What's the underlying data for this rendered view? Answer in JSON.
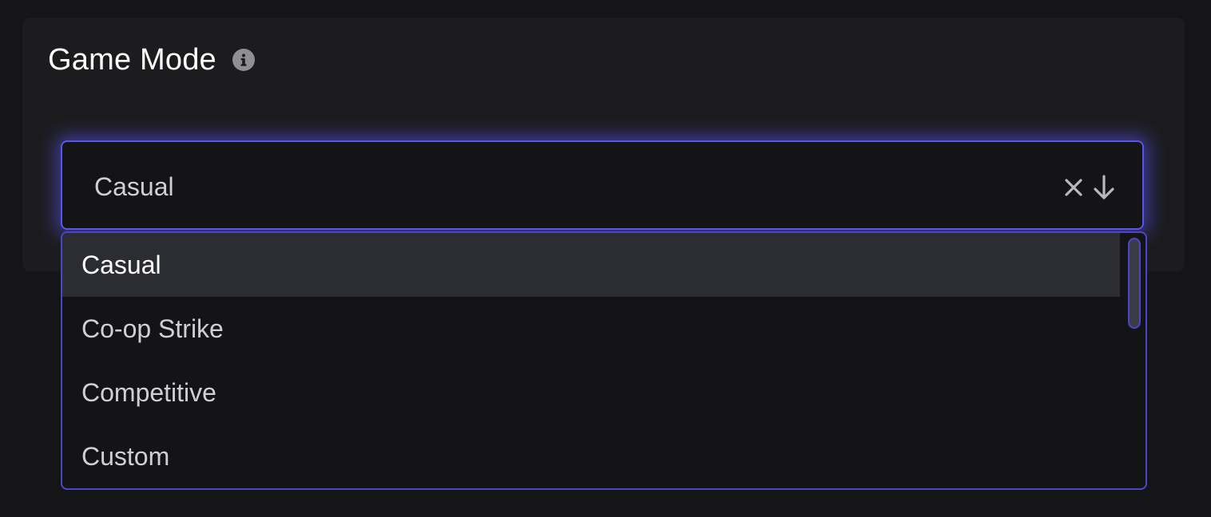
{
  "field": {
    "label": "Game Mode",
    "info_icon": "info-icon"
  },
  "select": {
    "value": "Casual",
    "clear_icon": "close-icon",
    "toggle_icon": "arrow-down-icon",
    "accent_color": "#5a54e6"
  },
  "dropdown": {
    "options": [
      {
        "label": "Casual",
        "highlighted": true
      },
      {
        "label": "Co-op Strike",
        "highlighted": false
      },
      {
        "label": "Competitive",
        "highlighted": false
      },
      {
        "label": "Custom",
        "highlighted": false
      }
    ]
  }
}
